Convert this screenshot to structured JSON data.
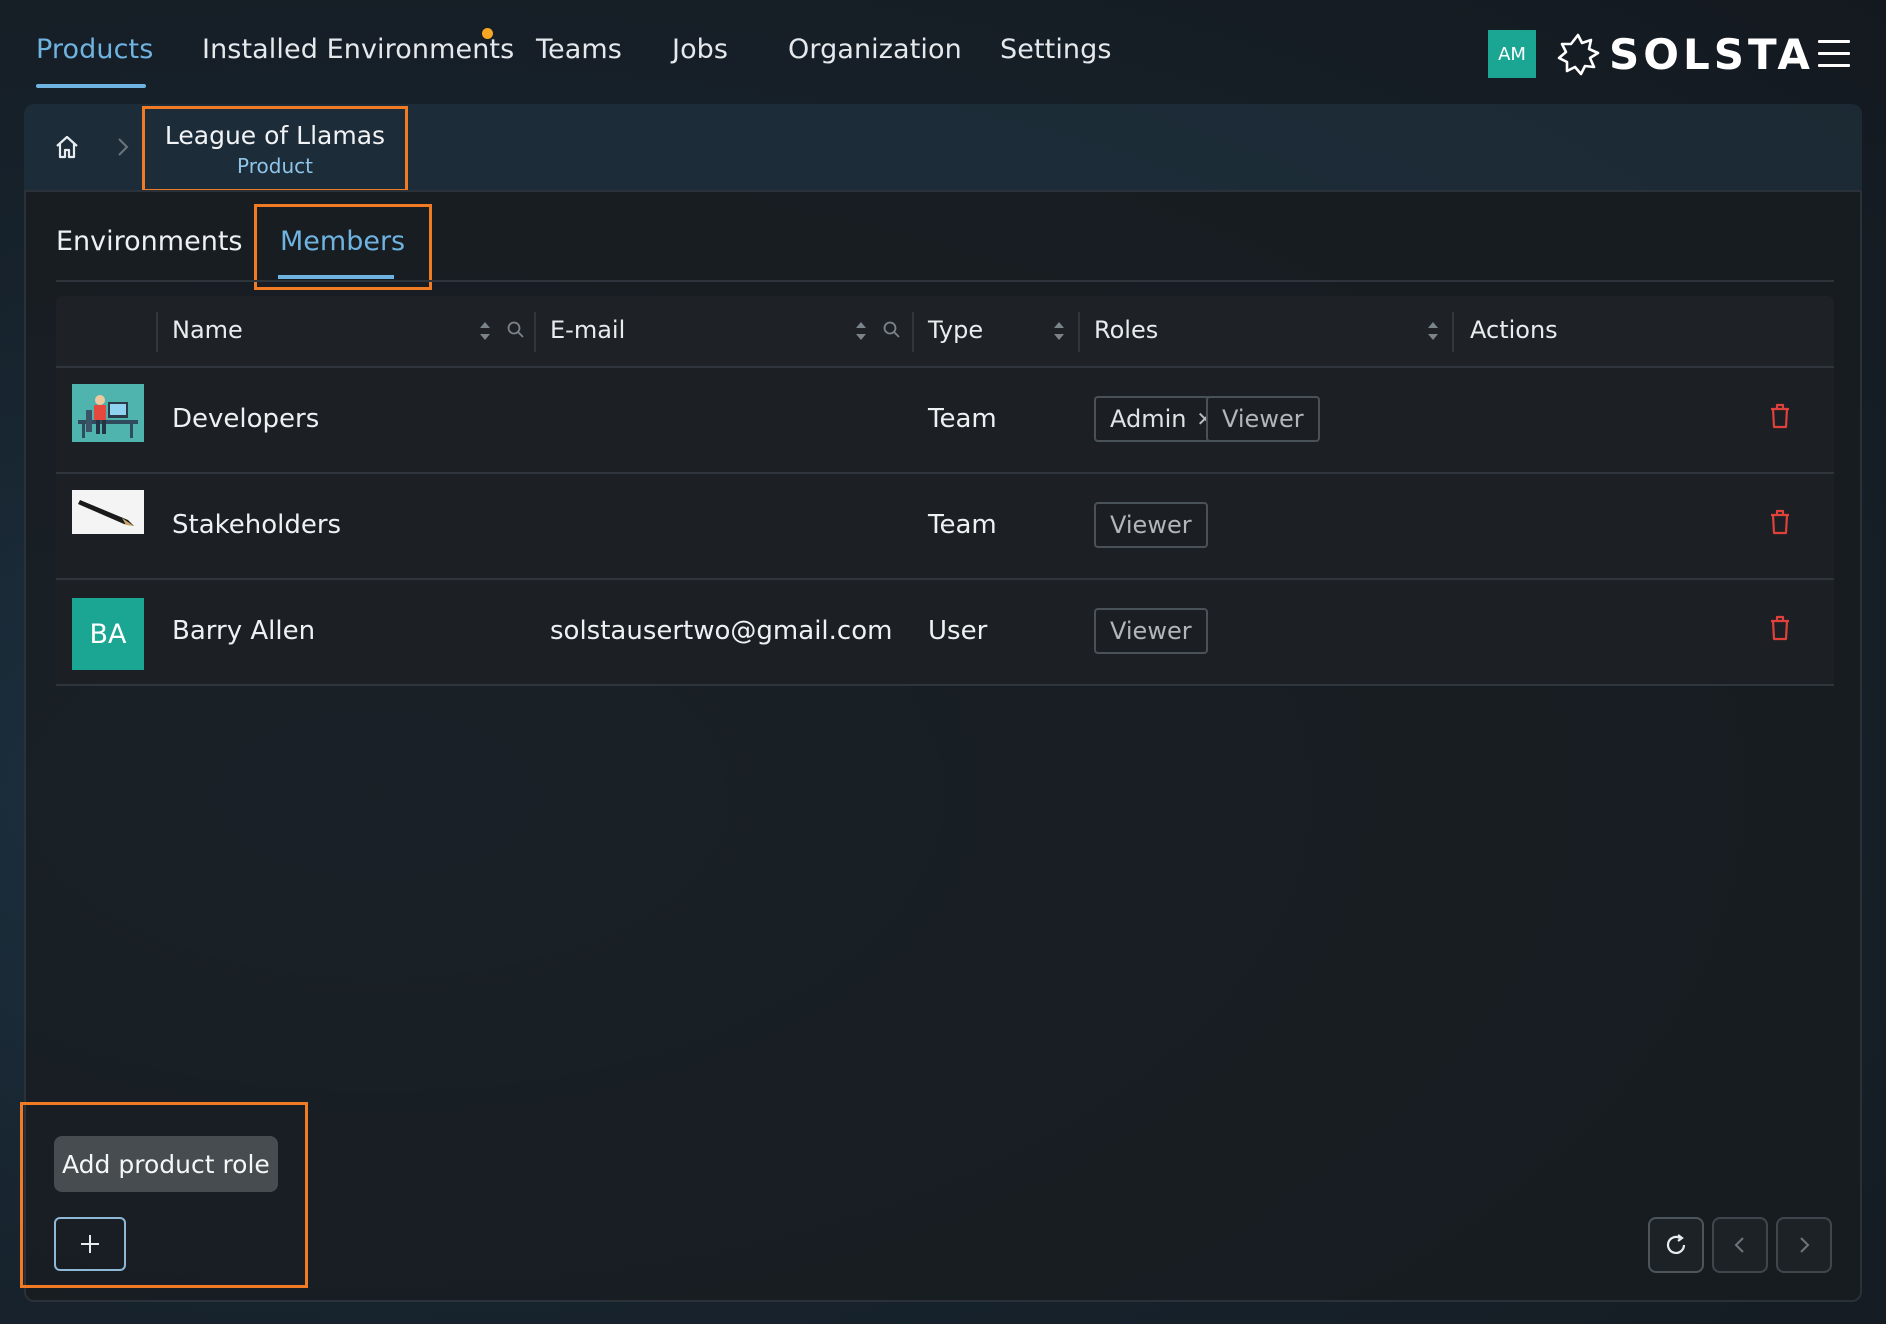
{
  "nav": {
    "items": [
      {
        "label": "Products",
        "active": true
      },
      {
        "label": "Installed Environments",
        "active": false,
        "has_notification": true
      },
      {
        "label": "Teams",
        "active": false
      },
      {
        "label": "Jobs",
        "active": false
      },
      {
        "label": "Organization",
        "active": false
      },
      {
        "label": "Settings",
        "active": false
      }
    ],
    "user_initials": "AM",
    "brand": "SOLSTA"
  },
  "breadcrumb": {
    "home_icon": "home-icon",
    "title": "League of Llamas",
    "subtitle": "Product"
  },
  "tabs": [
    {
      "label": "Environments",
      "active": false
    },
    {
      "label": "Members",
      "active": true
    }
  ],
  "table": {
    "columns": [
      "Name",
      "E-mail",
      "Type",
      "Roles",
      "Actions"
    ],
    "rows": [
      {
        "name": "Developers",
        "email": "",
        "type": "Team",
        "avatar": "team-image",
        "roles": [
          {
            "label": "Admin",
            "removable": true
          },
          {
            "label": "Viewer",
            "removable": false
          }
        ]
      },
      {
        "name": "Stakeholders",
        "email": "",
        "type": "Team",
        "avatar": "team-image",
        "roles": [
          {
            "label": "Viewer",
            "removable": false
          }
        ]
      },
      {
        "name": "Barry Allen",
        "email": "solstausertwo@gmail.com",
        "type": "User",
        "avatar_initials": "BA",
        "roles": [
          {
            "label": "Viewer",
            "removable": false
          }
        ]
      }
    ]
  },
  "footer": {
    "tooltip": "Add product role",
    "add_icon": "plus-icon",
    "refresh_icon": "refresh-icon",
    "prev_icon": "chevron-left-icon",
    "next_icon": "chevron-right-icon"
  },
  "colors": {
    "accent": "#6fb3e0",
    "highlight_box": "#f07b24",
    "avatar_teal": "#1aa692",
    "delete_red": "#e0413a",
    "notification": "#f5a623"
  }
}
